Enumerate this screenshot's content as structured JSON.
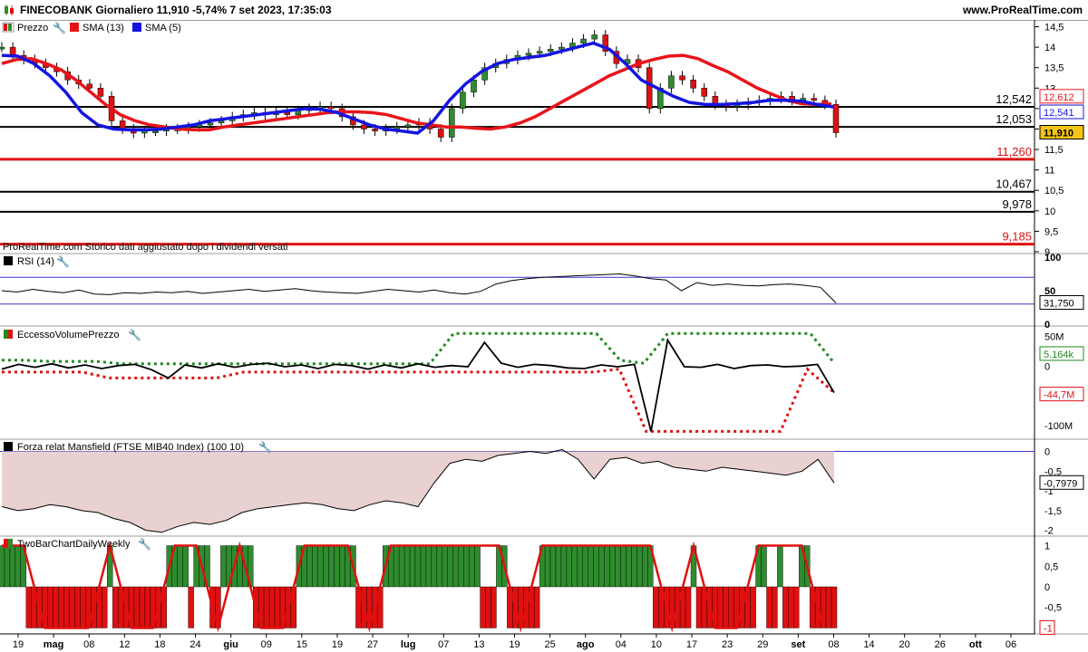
{
  "header": {
    "title": "FINECOBANK Giornaliero 11,910 -5,74% 7 set 2023, 17:35:03",
    "site": "www.ProRealTime.com"
  },
  "panels": {
    "price": {
      "legend_price": "Prezzo",
      "legend_sma13": "SMA (13)",
      "legend_sma5": "SMA (5)",
      "footnote": "ProRealTime.com Storico dati aggiustato dopo i dividendi versati"
    },
    "rsi": {
      "label": "RSI (14)"
    },
    "excess": {
      "label": "EccessoVolumePrezzo"
    },
    "mansfield": {
      "label": "Forza relat Mansfield (FTSE MIB40 Index) (100 10)"
    },
    "twobar": {
      "label": "TwoBarChartDailyWeekly"
    }
  },
  "colors": {
    "up": "#2e8b2e",
    "down": "#e01010",
    "sma13": "#e8141a",
    "sma5": "#1414e0",
    "support": "#e01010",
    "grid": "#000000",
    "current_badge": "#f5c518",
    "dot_green": "#1e8c1e",
    "dot_red": "#e01010",
    "mansfield_fill": "#e8cccc"
  },
  "chart_data": [
    {
      "type": "line",
      "title": "FINECOBANK Giornaliero",
      "series": [
        {
          "name": "Prezzo",
          "values": [
            14.0,
            13.8,
            13.7,
            13.6,
            13.5,
            13.4,
            13.2,
            13.1,
            13.0,
            12.8,
            12.2,
            12.0,
            11.9,
            11.95,
            11.95,
            12.0,
            12.0,
            12.05,
            12.1,
            12.15,
            12.2,
            12.3,
            12.35,
            12.4,
            12.35,
            12.4,
            12.35,
            12.45,
            12.5,
            12.55,
            12.5,
            12.3,
            12.1,
            12.0,
            11.95,
            12.0,
            12.05,
            12.1,
            12.15,
            12.0,
            11.8,
            12.5,
            12.9,
            13.2,
            13.5,
            13.6,
            13.7,
            13.8,
            13.85,
            13.9,
            13.95,
            14.0,
            14.1,
            14.2,
            14.3,
            13.9,
            13.6,
            13.7,
            13.5,
            12.5,
            13.0,
            13.3,
            13.2,
            13.0,
            12.8,
            12.6,
            12.55,
            12.6,
            12.65,
            12.7,
            12.75,
            12.8,
            12.7,
            12.75,
            12.7,
            12.6,
            11.91
          ]
        },
        {
          "name": "SMA (13)",
          "values": [
            13.6,
            13.7,
            13.72,
            13.6,
            13.45,
            13.2,
            12.9,
            12.6,
            12.35,
            12.2,
            12.1,
            12.05,
            12.0,
            11.98,
            11.98,
            12.05,
            12.1,
            12.15,
            12.2,
            12.25,
            12.3,
            12.35,
            12.4,
            12.42,
            12.42,
            12.4,
            12.35,
            12.25,
            12.15,
            12.1,
            12.05,
            12.05,
            12.02,
            12.0,
            12.05,
            12.15,
            12.3,
            12.5,
            12.7,
            12.9,
            13.1,
            13.3,
            13.45,
            13.6,
            13.7,
            13.78,
            13.8,
            13.72,
            13.55,
            13.4,
            13.2,
            13.0,
            12.85,
            12.7,
            12.62,
            12.6,
            12.612
          ]
        },
        {
          "name": "SMA (5)",
          "values": [
            13.8,
            13.78,
            13.6,
            13.3,
            12.9,
            12.4,
            12.1,
            12.0,
            11.98,
            11.98,
            12.0,
            12.05,
            12.1,
            12.2,
            12.25,
            12.3,
            12.35,
            12.4,
            12.45,
            12.5,
            12.48,
            12.4,
            12.25,
            12.1,
            12.0,
            11.95,
            11.9,
            12.2,
            12.7,
            13.1,
            13.4,
            13.6,
            13.7,
            13.75,
            13.8,
            13.9,
            14.0,
            14.1,
            13.95,
            13.6,
            13.2,
            13.0,
            12.8,
            12.65,
            12.6,
            12.6,
            12.62,
            12.65,
            12.7,
            12.7,
            12.68,
            12.6,
            12.541
          ]
        }
      ],
      "levels": [
        "12,542",
        "12,053",
        "11,260",
        "10,467",
        "9,978",
        "9,185"
      ],
      "badges": [
        "12,612",
        "12,541",
        "11,910"
      ],
      "yticks": [
        "14,5",
        "14",
        "13,5",
        "13",
        "12,5",
        "12",
        "11,5",
        "11",
        "10,5",
        "10",
        "9,5",
        "9"
      ],
      "ylim": [
        9,
        14.6
      ]
    },
    {
      "type": "line",
      "title": "RSI (14)",
      "series": [
        {
          "name": "RSI (14)",
          "values": [
            50,
            48,
            52,
            49,
            47,
            51,
            45,
            44,
            47,
            46,
            48,
            47,
            49,
            46,
            48,
            50,
            52,
            49,
            51,
            53,
            50,
            48,
            47,
            46,
            49,
            52,
            50,
            48,
            51,
            47,
            45,
            49,
            60,
            65,
            68,
            70,
            71,
            72,
            73,
            74,
            75,
            72,
            68,
            66,
            50,
            62,
            58,
            60,
            58,
            57,
            59,
            60,
            58,
            55,
            31.75
          ]
        }
      ],
      "yticks": [
        "100",
        "50",
        "0"
      ],
      "badge": "31,750",
      "ylim": [
        0,
        100
      ]
    },
    {
      "type": "line",
      "title": "EccessoVolumePrezzo",
      "series": [
        {
          "name": "EccessoVolumePrezzo",
          "values": [
            -5,
            3,
            -2,
            4,
            -3,
            2,
            -4,
            1,
            3,
            -6,
            -20,
            2,
            -3,
            4,
            -2,
            3,
            5,
            -1,
            2,
            -4,
            3,
            1,
            -5,
            2,
            -3,
            4,
            -2,
            1,
            -1,
            40,
            5,
            -2,
            3,
            1,
            -3,
            -4,
            2,
            -1,
            3,
            -110,
            44,
            -1,
            -2,
            3,
            -4,
            1,
            2,
            -1,
            0,
            3,
            -44.7
          ]
        },
        {
          "name": "upper",
          "values": [
            10,
            10,
            8,
            8,
            8,
            4,
            4,
            4,
            4,
            4,
            4,
            4,
            4,
            4,
            4,
            4,
            4,
            4,
            4,
            55,
            55,
            55,
            55,
            55,
            55,
            55,
            10,
            5,
            55,
            55,
            55,
            55,
            55,
            55,
            55,
            5.164
          ]
        },
        {
          "name": "lower",
          "values": [
            -10,
            -10,
            -10,
            -10,
            -20,
            -20,
            -20,
            -20,
            -20,
            -10,
            -10,
            -10,
            -10,
            -10,
            -10,
            -10,
            -10,
            -10,
            -10,
            -10,
            -10,
            -10,
            -10,
            -5,
            -110,
            -110,
            -110,
            -110,
            -110,
            -110,
            -5,
            -44.7
          ]
        }
      ],
      "yticks": [
        "50M",
        "0",
        "-44,7M",
        "-100M"
      ],
      "badges": [
        "5.164k",
        "0",
        "-44,7M"
      ],
      "ylim": [
        -120,
        60
      ]
    },
    {
      "type": "area",
      "title": "Forza relat Mansfield (FTSE MIB40 Index) (100 10)",
      "series": [
        {
          "name": "Mansfield",
          "values": [
            -1.4,
            -1.5,
            -1.45,
            -1.35,
            -1.4,
            -1.5,
            -1.55,
            -1.7,
            -1.8,
            -2.0,
            -2.05,
            -1.9,
            -1.8,
            -1.85,
            -1.75,
            -1.55,
            -1.45,
            -1.4,
            -1.35,
            -1.3,
            -1.35,
            -1.45,
            -1.5,
            -1.35,
            -1.25,
            -1.3,
            -1.4,
            -0.8,
            -0.3,
            -0.2,
            -0.25,
            -0.1,
            -0.05,
            0.0,
            -0.05,
            0.05,
            -0.2,
            -0.7,
            -0.2,
            -0.15,
            -0.3,
            -0.25,
            -0.4,
            -0.45,
            -0.5,
            -0.4,
            -0.45,
            -0.5,
            -0.55,
            -0.6,
            -0.5,
            -0.2,
            -0.7979
          ]
        }
      ],
      "yticks": [
        "0",
        "-0,5",
        "-1",
        "-1,5",
        "-2"
      ],
      "badge": "-0,7979",
      "ylim": [
        -2.1,
        0.15
      ]
    },
    {
      "type": "bar",
      "title": "TwoBarChartDailyWeekly",
      "series": [
        {
          "name": "TwoBarChartDailyWeekly",
          "values": [
            1,
            1,
            1,
            1,
            1,
            -1,
            -1,
            -1,
            -1,
            -1,
            -1,
            -1,
            -1,
            -1,
            -1,
            -1,
            -1,
            -1,
            -1,
            -1,
            1,
            -1,
            -1,
            -1,
            -1,
            -1,
            -1,
            -1,
            -1,
            -1,
            -1,
            1,
            1,
            1,
            1,
            -1,
            1,
            1,
            1,
            -1,
            -1,
            1,
            1,
            1,
            1,
            1,
            1,
            -1,
            -1,
            -1,
            -1,
            -1,
            -1,
            -1,
            -1,
            1,
            1,
            1,
            1,
            1,
            1,
            1,
            1,
            1,
            1,
            1,
            -1,
            -1,
            -1,
            -1,
            -1,
            1,
            1,
            1,
            1,
            1,
            1,
            1,
            1,
            1,
            1,
            1,
            1,
            1,
            1,
            1,
            1,
            1,
            1,
            -1,
            -1,
            -1,
            1,
            1,
            -1,
            -1,
            -1,
            -1,
            -1,
            -1,
            1,
            1,
            1,
            1,
            1,
            1,
            1,
            1,
            1,
            1,
            1,
            1,
            1,
            1,
            1,
            1,
            1,
            1,
            1,
            1,
            1,
            -1,
            -1,
            -1,
            -1,
            -1,
            -1,
            -1,
            1,
            -1,
            -1,
            -1,
            -1,
            -1,
            -1,
            -1,
            -1,
            -1,
            -1,
            -1,
            1,
            1,
            -1,
            -1,
            1,
            -1,
            -1,
            -1,
            1,
            1,
            -1,
            -1,
            -1,
            -1,
            -1
          ]
        }
      ],
      "yticks": [
        "1",
        "0,5",
        "0",
        "-0,5",
        "-1"
      ],
      "badge": "-1",
      "ylim": [
        -1.1,
        1.1
      ]
    }
  ],
  "x_labels": [
    "19",
    "mag",
    "08",
    "12",
    "18",
    "24",
    "giu",
    "09",
    "15",
    "19",
    "27",
    "lug",
    "07",
    "13",
    "19",
    "25",
    "ago",
    "04",
    "10",
    "17",
    "23",
    "29",
    "set",
    "08",
    "14",
    "20",
    "26",
    "ott",
    "06"
  ]
}
